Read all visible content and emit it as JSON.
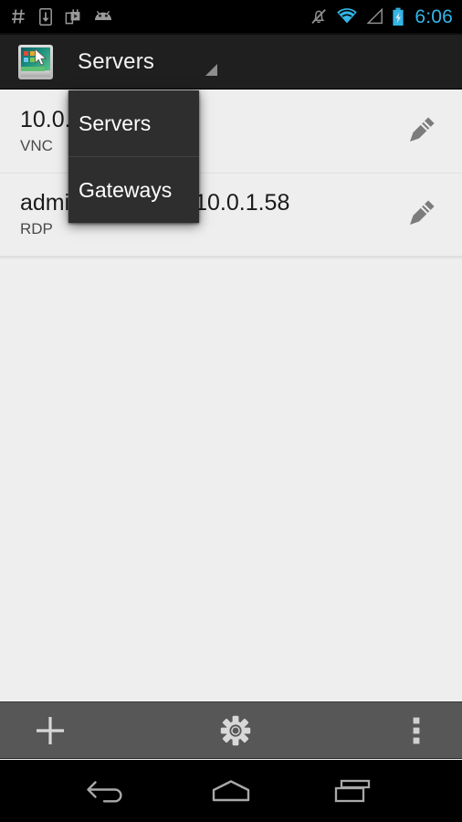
{
  "statusbar": {
    "time": "6:06",
    "left_icons": [
      {
        "name": "hash-icon",
        "glyph": "#"
      },
      {
        "name": "download-to-device-icon",
        "glyph": "download"
      },
      {
        "name": "play-store-icon",
        "glyph": "store-bag"
      },
      {
        "name": "android-robot-icon",
        "glyph": "android-head"
      }
    ],
    "right_icons": [
      {
        "name": "mute-icon",
        "glyph": "bell-crossed"
      },
      {
        "name": "wifi-icon",
        "glyph": "wifi-full"
      },
      {
        "name": "cell-signal-icon",
        "glyph": "signal-empty"
      },
      {
        "name": "battery-charging-icon",
        "glyph": "battery-bolt"
      }
    ],
    "colors": {
      "accent": "#33b5e5",
      "background": "#000000"
    }
  },
  "actionbar": {
    "app_icon_name": "app-icon-remote-desktop",
    "title": "Servers",
    "spinner_caret_name": "spinner-caret-icon",
    "background": "#1f1f1f"
  },
  "dropdown": {
    "open": true,
    "items": [
      {
        "label": "Servers",
        "name": "dropdown-item-servers"
      },
      {
        "label": "Gateways",
        "name": "dropdown-item-gateways"
      }
    ],
    "background": "#2e2e2e"
  },
  "list": {
    "rows": [
      {
        "title": "10.0.1.57",
        "subtitle": "VNC",
        "edit_icon": "pencil-icon"
      },
      {
        "title": "admin@mingw@10.0.1.58",
        "subtitle": "RDP",
        "edit_icon": "pencil-icon"
      }
    ]
  },
  "bottombar": {
    "background": "#575757",
    "buttons": [
      {
        "name": "add-server-button",
        "icon": "plus-icon",
        "label": "Add"
      },
      {
        "name": "settings-button",
        "icon": "gear-icon",
        "label": "Settings"
      },
      {
        "name": "overflow-menu-button",
        "icon": "more-vertical-icon",
        "label": "More options"
      }
    ]
  },
  "navbar": {
    "buttons": [
      {
        "name": "nav-back-button",
        "icon": "back-arrow-icon",
        "label": "Back"
      },
      {
        "name": "nav-home-button",
        "icon": "home-icon",
        "label": "Home"
      },
      {
        "name": "nav-recents-button",
        "icon": "recents-icon",
        "label": "Recent apps"
      }
    ]
  }
}
